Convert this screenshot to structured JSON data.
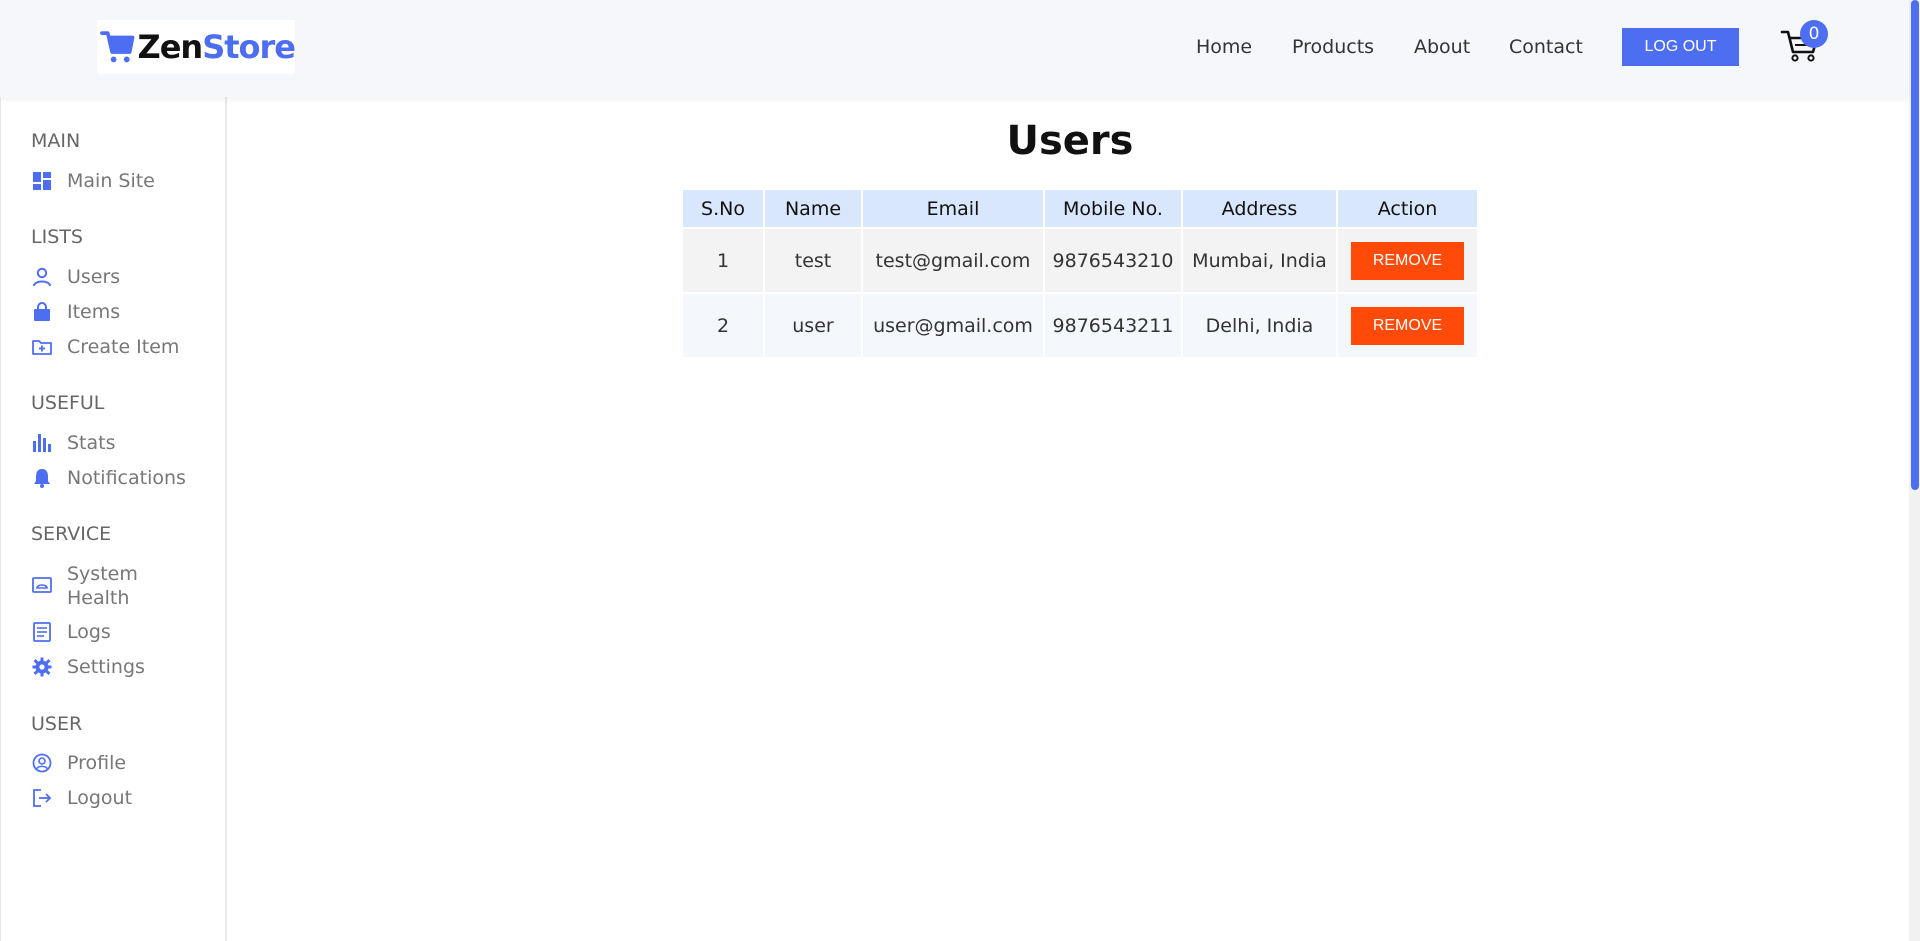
{
  "brand": {
    "name_part1": "Zen",
    "name_part2": "Store"
  },
  "nav": {
    "home": "Home",
    "products": "Products",
    "about": "About",
    "contact": "Contact",
    "logout": "LOG OUT",
    "cart_count": "0"
  },
  "sidebar": {
    "main_title": "MAIN",
    "main_site": "Main Site",
    "lists_title": "LISTS",
    "users": "Users",
    "items": "Items",
    "create_item": "Create Item",
    "useful_title": "USEFUL",
    "stats": "Stats",
    "notifications": "Notifications",
    "service_title": "SERVICE",
    "system_health": "System Health",
    "logs": "Logs",
    "settings": "Settings",
    "user_title": "USER",
    "profile": "Profile",
    "logout": "Logout"
  },
  "page": {
    "title": "Users"
  },
  "table": {
    "headers": [
      "S.No",
      "Name",
      "Email",
      "Mobile No.",
      "Address",
      "Action"
    ],
    "rows": [
      {
        "sno": "1",
        "name": "test",
        "email": "test@gmail.com",
        "mobile": "9876543210",
        "address": "Mumbai, India",
        "action": "REMOVE"
      },
      {
        "sno": "2",
        "name": "user",
        "email": "user@gmail.com",
        "mobile": "9876543211",
        "address": "Delhi, India",
        "action": "REMOVE"
      }
    ]
  },
  "colors": {
    "accent": "#4e6ef2",
    "danger": "#ff4a0a",
    "header_bg": "#f5f7fb",
    "table_header_bg": "#d8e7fb"
  }
}
